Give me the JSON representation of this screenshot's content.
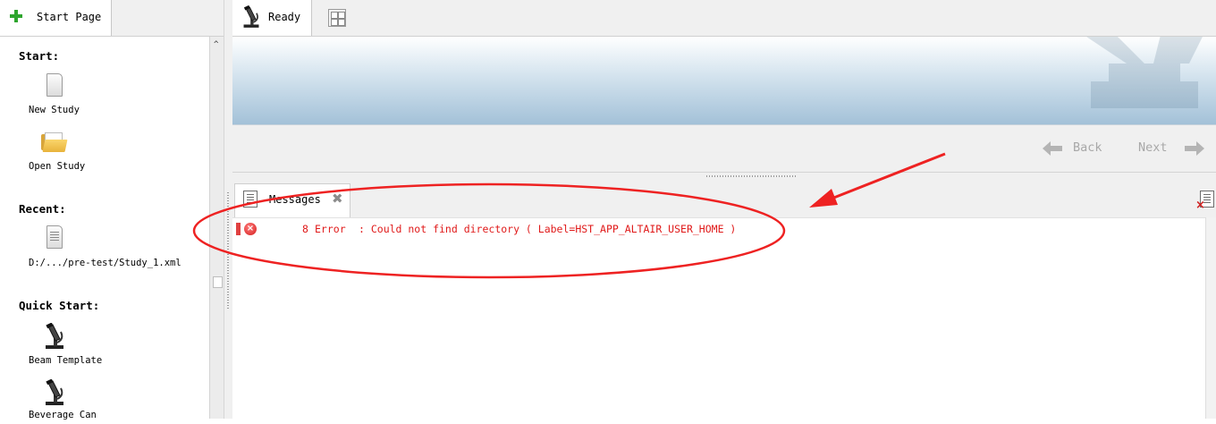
{
  "left_panel": {
    "tab_label": "Start Page",
    "sections": {
      "start": "Start:",
      "recent": "Recent:",
      "quick_start": "Quick Start:"
    },
    "start_items": [
      {
        "label": "New Study",
        "icon": "new-document-icon"
      },
      {
        "label": "Open Study",
        "icon": "open-folder-icon"
      }
    ],
    "recent_items": [
      {
        "label": "D:/.../pre-test/Study_1.xml",
        "icon": "xml-document-icon"
      }
    ],
    "quick_start_items": [
      {
        "label": "Beam Template",
        "icon": "microscope-icon"
      },
      {
        "label": "Beverage Can",
        "icon": "microscope-icon"
      }
    ]
  },
  "workspace": {
    "tab_label": "Ready",
    "back_label": "Back",
    "next_label": "Next"
  },
  "messages": {
    "tab_label": "Messages",
    "entries": [
      {
        "count": "8",
        "severity": "Error",
        "text": ": Could not find directory ( Label=HST_APP_ALTAIR_USER_HOME )"
      }
    ]
  },
  "colors": {
    "error": "#e01a1a",
    "annotation": "#ee2222",
    "plus_green": "#2ea52e"
  }
}
